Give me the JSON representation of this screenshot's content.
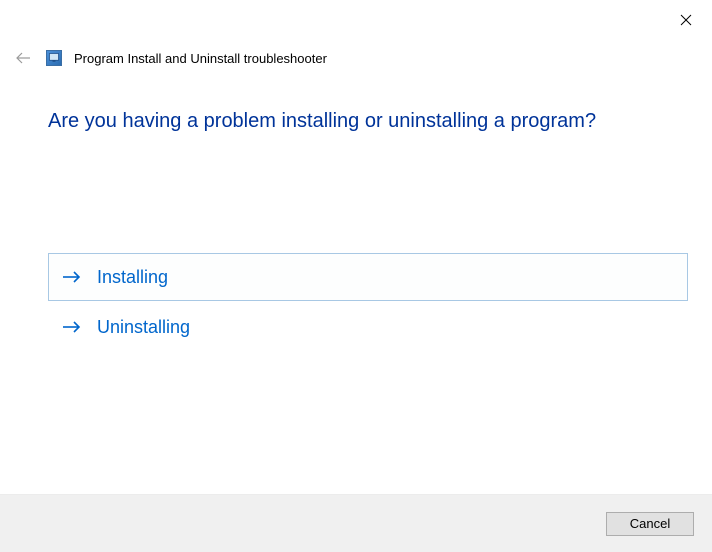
{
  "window": {
    "title": "Program Install and Uninstall troubleshooter"
  },
  "main": {
    "question": "Are you having a problem installing or uninstalling a program?",
    "options": [
      {
        "label": "Installing",
        "selected": true
      },
      {
        "label": "Uninstalling",
        "selected": false
      }
    ]
  },
  "footer": {
    "cancel_label": "Cancel"
  },
  "icons": {
    "close": "close-icon",
    "back": "back-arrow-icon",
    "app": "troubleshooter-app-icon",
    "option_arrow": "right-arrow-icon"
  }
}
